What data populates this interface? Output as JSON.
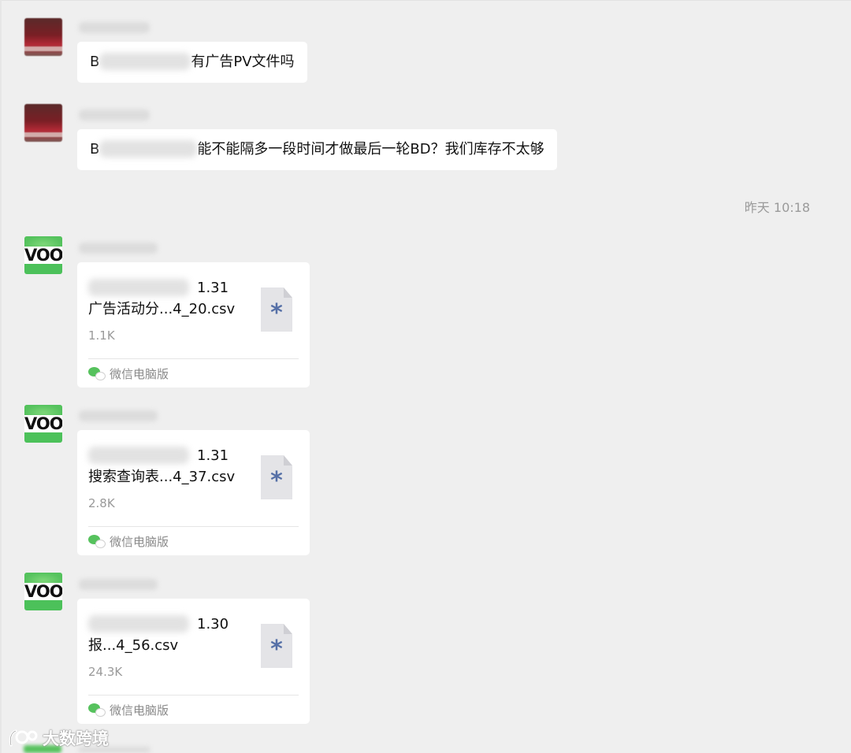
{
  "messages": [
    {
      "type": "text",
      "prefix": "B",
      "suffix": "有广告PV文件吗"
    },
    {
      "type": "text",
      "prefix": "B",
      "suffix": "能不能隔多一段时间才做最后一轮BD？我们库存不太够"
    }
  ],
  "timestamp": "昨天 10:18",
  "files": [
    {
      "line1_visible": "1.31",
      "line2": "广告活动分...4_20.csv",
      "size": "1.1K",
      "source": "微信电脑版"
    },
    {
      "line1_visible": "1.31",
      "line2": "搜索查询表...4_37.csv",
      "size": "2.8K",
      "source": "微信电脑版"
    },
    {
      "line1_visible": "1.30",
      "line2": "报...4_56.csv",
      "size": "24.3K",
      "source": "微信电脑版"
    }
  ],
  "avatar_text": "VOOT",
  "file_icon_glyph": "*",
  "watermark": "大数跨境",
  "colors": {
    "background": "#efefef",
    "bubble": "#ffffff",
    "wechat_green": "#56c25d",
    "file_star": "#5670a7",
    "muted_text": "#9a9a9a"
  },
  "icons": [
    "file-icon",
    "wechat-icon",
    "watermark-logo-icon"
  ]
}
